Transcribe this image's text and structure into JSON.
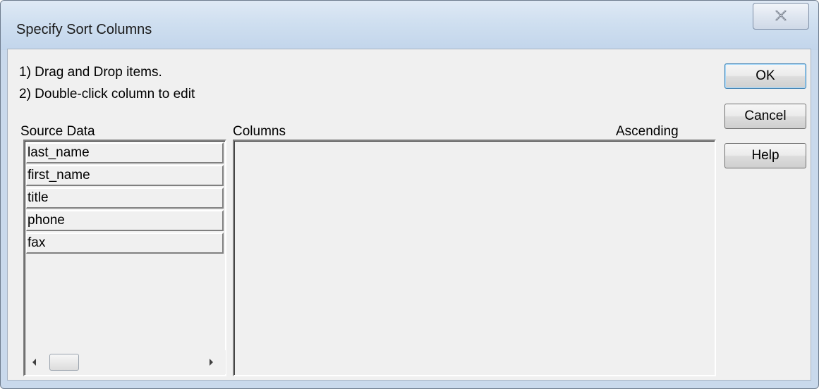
{
  "window": {
    "title": "Specify Sort Columns"
  },
  "instructions": [
    "1) Drag and Drop items.",
    "2) Double-click column to edit"
  ],
  "source": {
    "label": "Source Data",
    "items": [
      "last_name",
      "first_name",
      "title",
      "phone",
      "fax"
    ]
  },
  "columns": {
    "label": "Columns",
    "ascending_label": "Ascending"
  },
  "buttons": {
    "ok": "OK",
    "cancel": "Cancel",
    "help": "Help"
  }
}
